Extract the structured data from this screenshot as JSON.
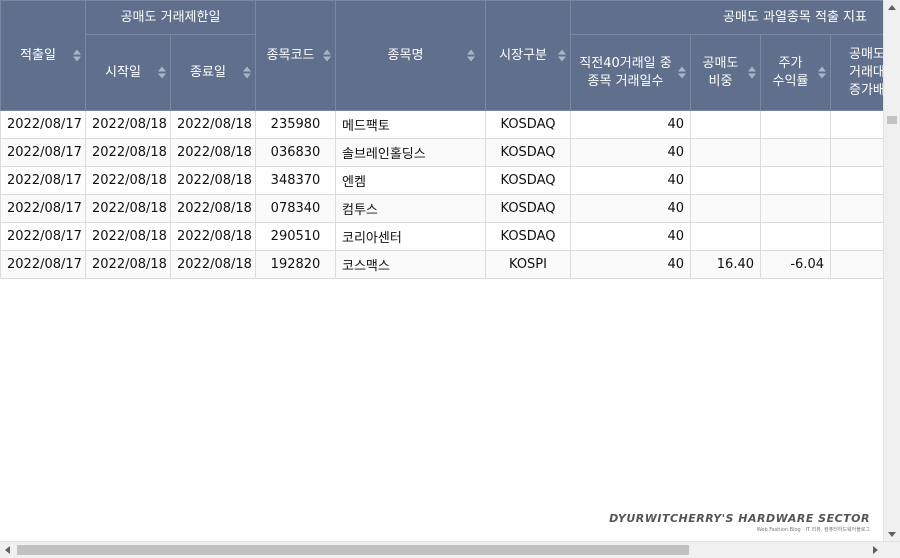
{
  "header": {
    "col_date": "적출일",
    "group_limit": "공매도 거래제한일",
    "col_start": "시작일",
    "col_end": "종료일",
    "col_code": "종목코드",
    "col_name": "종목명",
    "col_market": "시장구분",
    "group_indicator": "공매도 과열종목 적출 지표",
    "col_days_1": "직전40거래일 중",
    "col_days_2": "종목 거래일수",
    "col_ratio_1": "공매도",
    "col_ratio_2": "비중",
    "col_return_1": "주가",
    "col_return_2": "수익률",
    "col_more_1": "공매도",
    "col_more_2": "거래대금",
    "col_more_3": "증가배율"
  },
  "rows": [
    {
      "date": "2022/08/17",
      "start": "2022/08/18",
      "end": "2022/08/18",
      "code": "235980",
      "name": "메드팩토",
      "market": "KOSDAQ",
      "days": "40",
      "ratio": "",
      "ret": "",
      "more": ""
    },
    {
      "date": "2022/08/17",
      "start": "2022/08/18",
      "end": "2022/08/18",
      "code": "036830",
      "name": "솔브레인홀딩스",
      "market": "KOSDAQ",
      "days": "40",
      "ratio": "",
      "ret": "",
      "more": "-"
    },
    {
      "date": "2022/08/17",
      "start": "2022/08/18",
      "end": "2022/08/18",
      "code": "348370",
      "name": "엔켐",
      "market": "KOSDAQ",
      "days": "40",
      "ratio": "",
      "ret": "",
      "more": ""
    },
    {
      "date": "2022/08/17",
      "start": "2022/08/18",
      "end": "2022/08/18",
      "code": "078340",
      "name": "컴투스",
      "market": "KOSDAQ",
      "days": "40",
      "ratio": "",
      "ret": "",
      "more": ""
    },
    {
      "date": "2022/08/17",
      "start": "2022/08/18",
      "end": "2022/08/18",
      "code": "290510",
      "name": "코리아센터",
      "market": "KOSDAQ",
      "days": "40",
      "ratio": "",
      "ret": "",
      "more": ""
    },
    {
      "date": "2022/08/17",
      "start": "2022/08/18",
      "end": "2022/08/18",
      "code": "192820",
      "name": "코스맥스",
      "market": "KOSPI",
      "days": "40",
      "ratio": "16.40",
      "ret": "-6.04",
      "more": ""
    }
  ],
  "watermark": {
    "title": "DYURWITCHERRY'S HARDWARE SECTOR",
    "subtitle": "Web Fashion Blog · IT 리뷰, 컴퓨터하드웨어블로그"
  }
}
